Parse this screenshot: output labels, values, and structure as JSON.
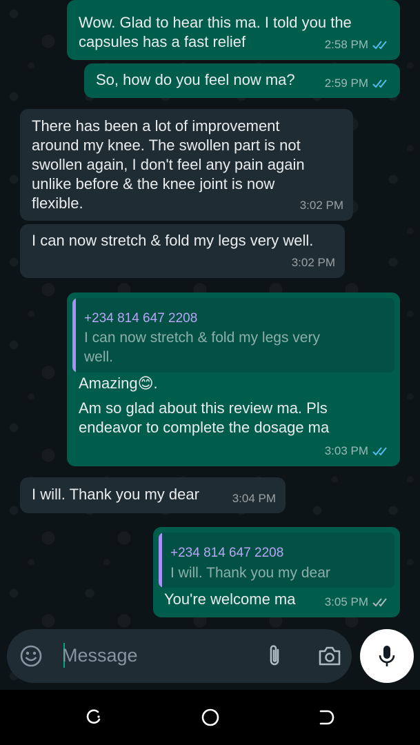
{
  "chat": {
    "messages": [
      {
        "text": "Wow. Glad to hear this ma. I told you the\ncapsules has a fast relief",
        "time": "2:58 PM"
      },
      {
        "text": "So, how do you feel now ma?",
        "time": "2:59 PM"
      },
      {
        "text": "There has been a lot of improvement\naround my knee. The swollen part is not\nswollen again, I don't feel any pain again\nunlike before & the knee joint is now\nflexible.",
        "time": "3:02 PM"
      },
      {
        "text": "I can now stretch & fold my legs very well.",
        "time": "3:02 PM"
      },
      {
        "quote_name": "+234 814 647 2208",
        "quote_text": "I can now stretch & fold my legs very\nwell.",
        "text_line1": "Amazing",
        "emoji": "😊",
        "text_line1_end": ".",
        "text_rest": "Am so glad about this review ma. Pls\nendeavor to complete the dosage ma",
        "time": "3:03 PM"
      },
      {
        "text": "I will. Thank you my dear",
        "time": "3:04 PM"
      },
      {
        "quote_name": "+234 814 647 2208",
        "quote_text": "I will. Thank you my dear",
        "text": "You're welcome ma",
        "time": "3:05 PM"
      }
    ]
  },
  "composer": {
    "placeholder": "Message",
    "emoji_icon": "emoji-icon",
    "attach_icon": "paperclip-icon",
    "camera_icon": "camera-icon",
    "mic_icon": "microphone-icon"
  },
  "navbar": {
    "recents_icon": "recents-icon",
    "home_icon": "home-icon",
    "back_icon": "back-icon"
  },
  "colors": {
    "outgoing_bubble": "#005c4b",
    "incoming_bubble": "#202c33",
    "quote_accent": "#a791f4",
    "read_ticks": "#53bdeb"
  }
}
